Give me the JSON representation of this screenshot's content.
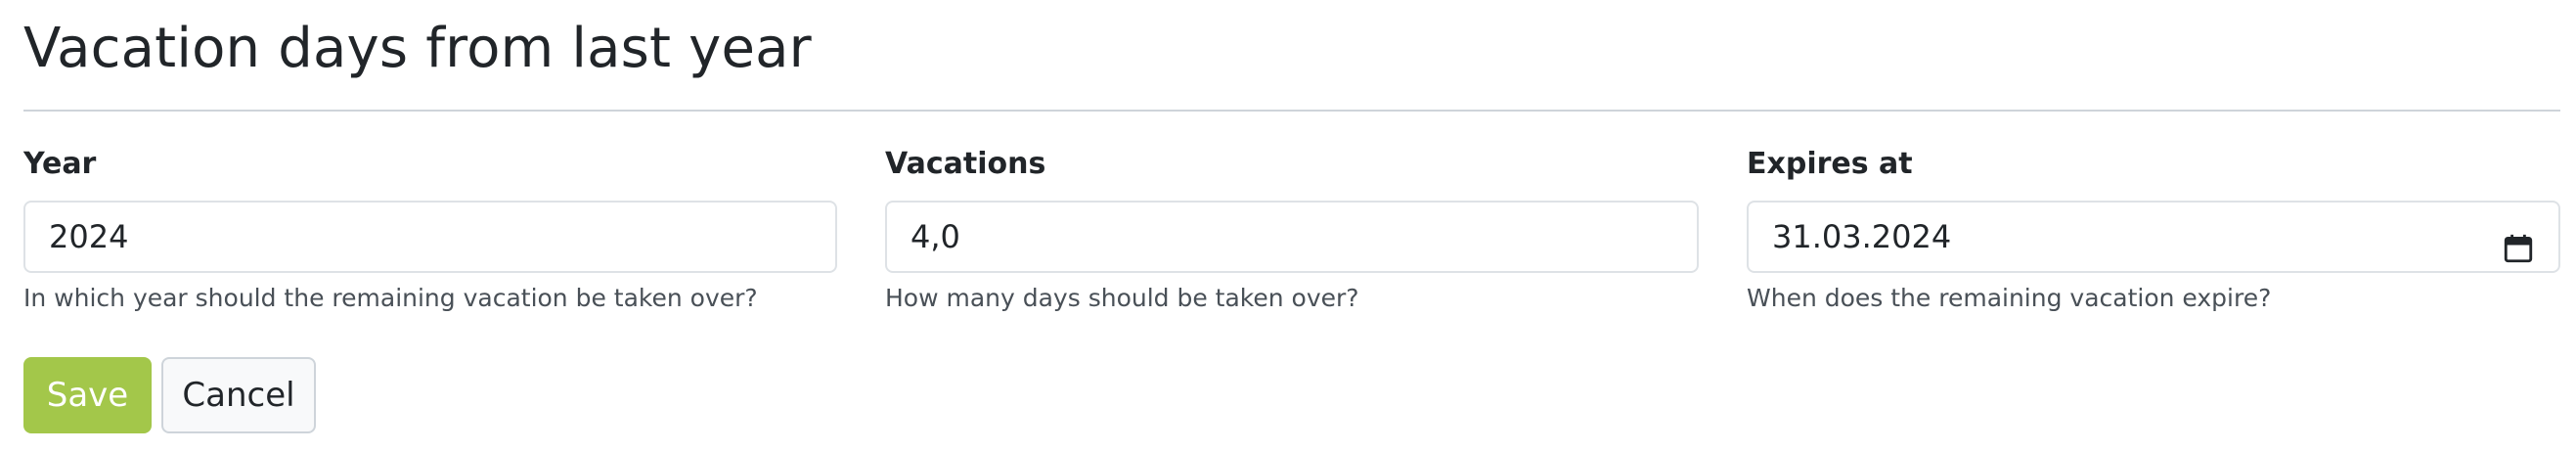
{
  "page": {
    "title": "Vacation days from last year"
  },
  "fields": {
    "year": {
      "label": "Year",
      "value": "2024",
      "help": "In which year should the remaining vacation be taken over?"
    },
    "vacations": {
      "label": "Vacations",
      "value": "4,0",
      "help": "How many days should be taken over?"
    },
    "expires_at": {
      "label": "Expires at",
      "value": "31.03.2024",
      "help": "When does the remaining vacation expire?",
      "icon": "calendar-icon"
    }
  },
  "actions": {
    "save_label": "Save",
    "cancel_label": "Cancel"
  },
  "colors": {
    "save_button": "#a3c74a",
    "text": "#212529",
    "help_text": "#495057",
    "input_border": "#dee2e6"
  }
}
